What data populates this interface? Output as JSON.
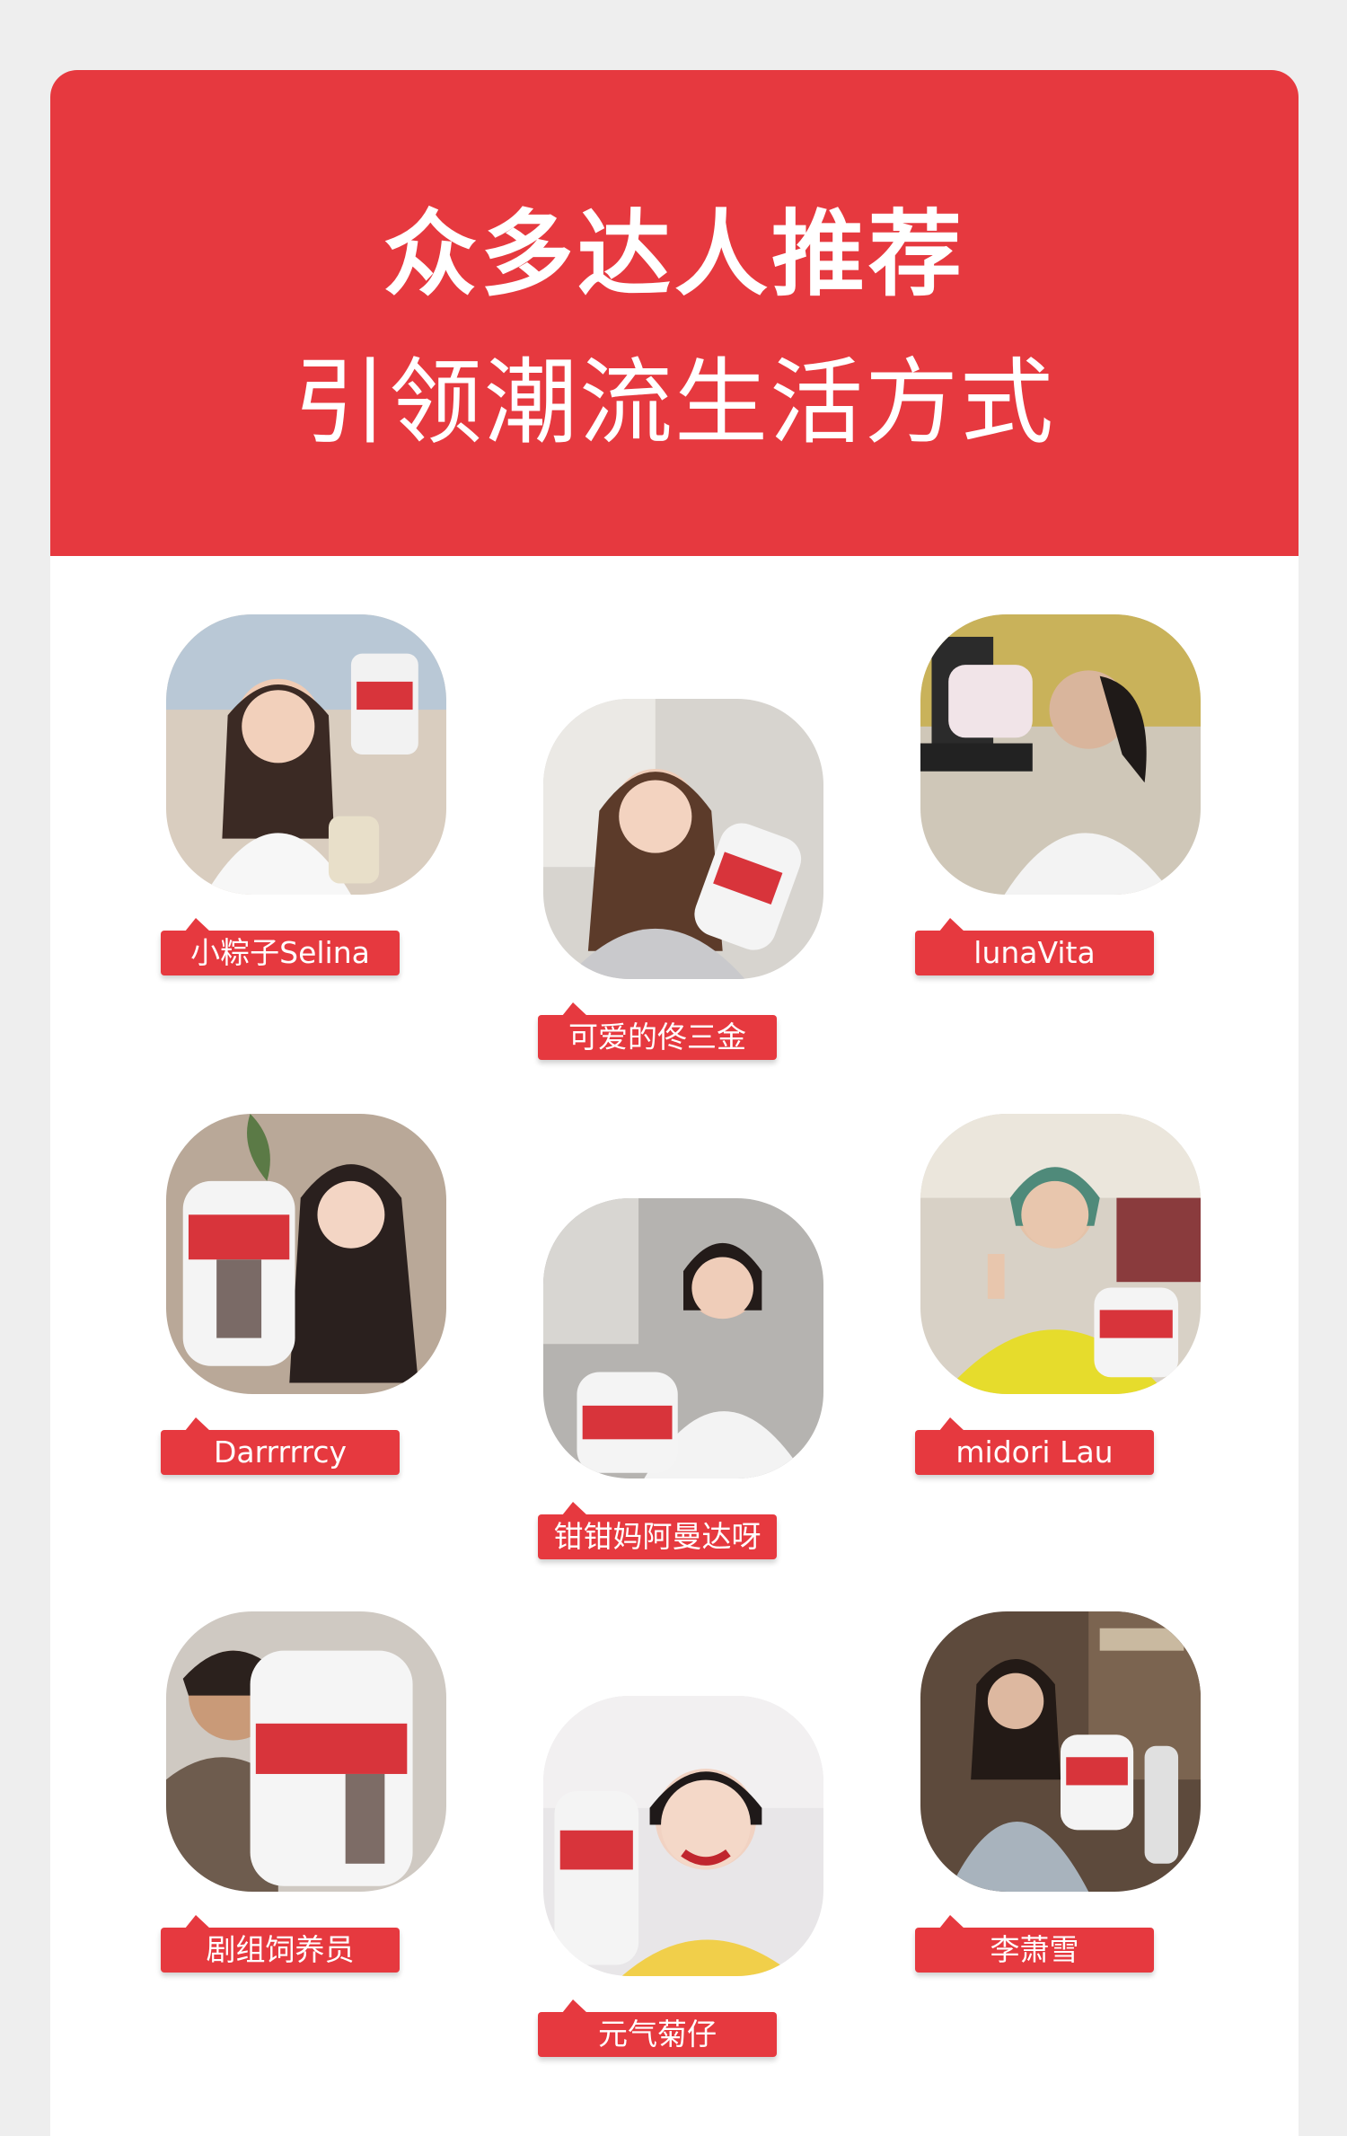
{
  "page": {
    "heading": "众多达人推荐",
    "subheading": "引领潮流生活方式"
  },
  "colors": {
    "brand_red": "#e6393f",
    "panel_white": "#ffffff",
    "page_background": "#eeeeee"
  },
  "influencers": [
    {
      "name": "小粽子Selina",
      "photo_icon": "influencer-photo-icon"
    },
    {
      "name": "可爱的佟三金",
      "photo_icon": "influencer-photo-icon"
    },
    {
      "name": "lunaVita",
      "photo_icon": "influencer-photo-icon"
    },
    {
      "name": "Darrrrrcy",
      "photo_icon": "influencer-photo-icon"
    },
    {
      "name": "钳钳妈阿曼达呀",
      "photo_icon": "influencer-photo-icon"
    },
    {
      "name": "midori Lau",
      "photo_icon": "influencer-photo-icon"
    },
    {
      "name": "剧组饲养员",
      "photo_icon": "influencer-photo-icon"
    },
    {
      "name": "元气菊仔",
      "photo_icon": "influencer-photo-icon"
    },
    {
      "name": "李萧雪",
      "photo_icon": "influencer-photo-icon"
    }
  ]
}
